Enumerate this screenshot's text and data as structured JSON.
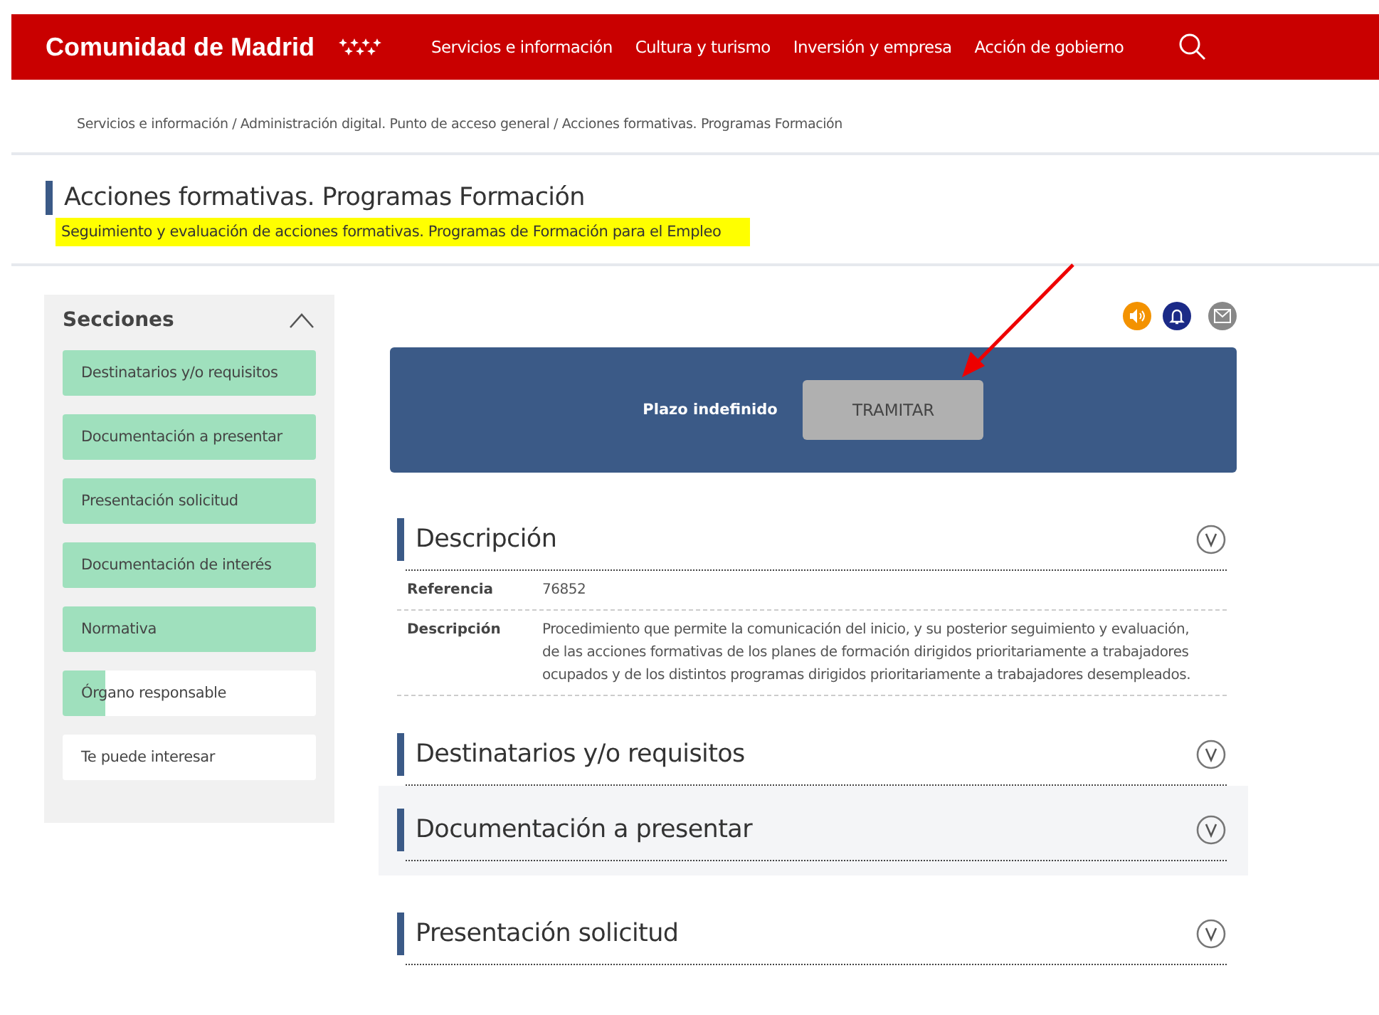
{
  "header": {
    "logo": "Comunidad de Madrid",
    "nav": [
      "Servicios e información",
      "Cultura y turismo",
      "Inversión y empresa",
      "Acción de gobierno"
    ]
  },
  "breadcrumb": "Servicios e información / Administración digital. Punto de acceso general / Acciones formativas. Programas Formación",
  "page": {
    "title": "Acciones formativas. Programas Formación",
    "subtitle": "Seguimiento y evaluación de acciones formativas. Programas de Formación para el Empleo"
  },
  "sidebar": {
    "title": "Secciones",
    "expanded": true,
    "items": [
      {
        "label": "Destinatarios y/o requisitos",
        "level": 1
      },
      {
        "label": "Documentación a presentar",
        "level": 1
      },
      {
        "label": "Presentación solicitud",
        "level": 1
      },
      {
        "label": "Documentación de interés",
        "level": 1
      },
      {
        "label": "Normativa",
        "level": 1
      },
      {
        "label": "Órgano responsable",
        "level": 0.17
      },
      {
        "label": "Te puede interesar"
      }
    ]
  },
  "procedure": {
    "deadline": "Plazo indefinido",
    "button": "TRAMITAR"
  },
  "sections": [
    {
      "title": "Descripción",
      "highlighted": false,
      "rows": [
        {
          "label": "Referencia",
          "value": "76852"
        },
        {
          "label": "Descripción",
          "value": "Procedimiento que permite la comunicación del inicio, y su posterior seguimiento y evaluación, de las acciones formativas de los planes de formación dirigidos prioritariamente a trabajadores ocupados y de los distintos programas dirigidos prioritariamente a trabajadores desempleados."
        }
      ]
    },
    {
      "title": "Destinatarios y/o requisitos",
      "highlighted": false
    },
    {
      "title": "Documentación a presentar",
      "highlighted": true
    },
    {
      "title": "Presentación solicitud",
      "highlighted": false
    }
  ]
}
